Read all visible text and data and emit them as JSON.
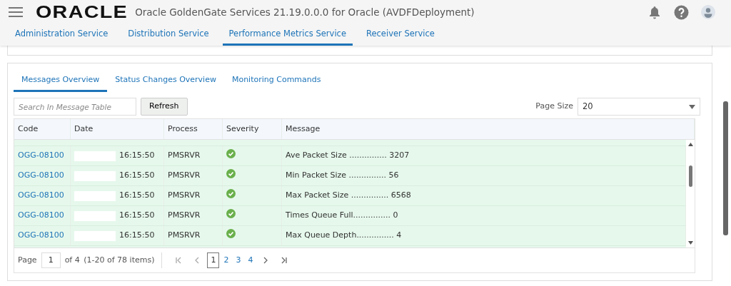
{
  "header": {
    "logo": "ORACLE",
    "title": "Oracle GoldenGate Services 21.19.0.0.0 for Oracle (AVDFDeployment)"
  },
  "service_tabs": [
    {
      "label": "Administration Service",
      "selected": false
    },
    {
      "label": "Distribution Service",
      "selected": false
    },
    {
      "label": "Performance Metrics Service",
      "selected": true
    },
    {
      "label": "Receiver Service",
      "selected": false
    }
  ],
  "message_tabs": [
    {
      "label": "Messages Overview",
      "selected": true
    },
    {
      "label": "Status Changes Overview",
      "selected": false
    },
    {
      "label": "Monitoring Commands",
      "selected": false
    }
  ],
  "search": {
    "placeholder": "Search In Message Table"
  },
  "refresh_button": "Refresh",
  "page_size": {
    "label": "Page Size",
    "value": "20"
  },
  "table": {
    "columns": [
      "Code",
      "Date",
      "Process",
      "Severity",
      "Message"
    ],
    "rows": [
      {
        "code": "OGG-08100",
        "time": "16:15:50",
        "process": "PMSRVR",
        "kind": "success",
        "message": "Ave Packet Size ............... 3207"
      },
      {
        "code": "OGG-08100",
        "time": "16:15:50",
        "process": "PMSRVR",
        "kind": "success",
        "message": "Min Packet Size ............... 56"
      },
      {
        "code": "OGG-08100",
        "time": "16:15:50",
        "process": "PMSRVR",
        "kind": "success",
        "message": "Max Packet Size ............... 6568"
      },
      {
        "code": "OGG-08100",
        "time": "16:15:50",
        "process": "PMSRVR",
        "kind": "success",
        "message": "Times Queue Full............... 0"
      },
      {
        "code": "OGG-08100",
        "time": "16:15:50",
        "process": "PMSRVR",
        "kind": "success",
        "message": "Max Queue Depth............... 4"
      }
    ]
  },
  "pager": {
    "page_label": "Page",
    "page": "1",
    "of": "of 4",
    "range": "(1-20 of 78 items)",
    "pages": [
      {
        "label": "1",
        "selected": true
      },
      {
        "label": "2",
        "selected": false
      },
      {
        "label": "3",
        "selected": false
      },
      {
        "label": "4",
        "selected": false
      }
    ]
  }
}
